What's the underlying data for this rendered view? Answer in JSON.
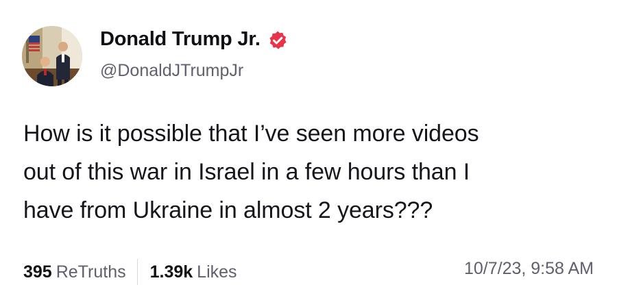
{
  "author": {
    "display_name": "Donald Trump Jr.",
    "handle": "@DonaldJTrumpJr",
    "verified": true,
    "verified_badge_color": "#e8334a"
  },
  "post": {
    "text_lines": [
      "How is it possible that I’ve seen more videos",
      "out of this war in Israel in a few hours than I",
      "have from Ukraine in almost 2 years???"
    ]
  },
  "stats": {
    "retruths_count": "395",
    "retruths_label": "ReTruths",
    "likes_count": "1.39k",
    "likes_label": "Likes"
  },
  "timestamp": "10/7/23, 9:58 AM",
  "icons": {
    "avatar": "profile-photo",
    "verified": "verified-badge-icon"
  }
}
